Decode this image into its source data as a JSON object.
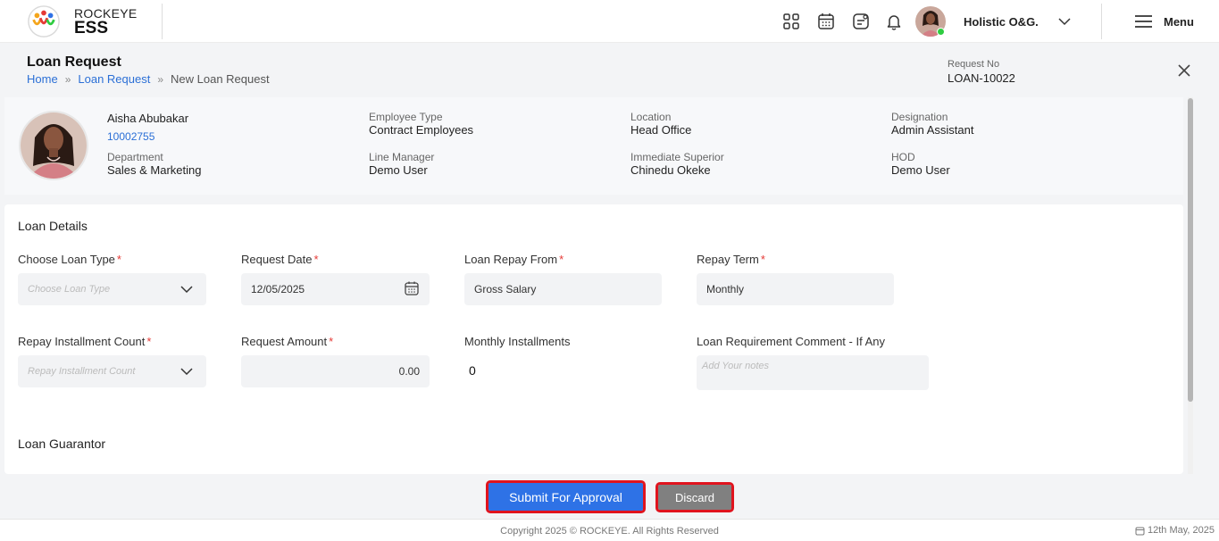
{
  "header": {
    "brand_top": "ROCKEYE",
    "brand_bottom": "ESS",
    "company": "Holistic O&G.",
    "menu_label": "Menu",
    "icons": [
      "apps-grid-icon",
      "calendar-icon",
      "chat-icon",
      "bell-icon"
    ]
  },
  "page": {
    "title": "Loan Request",
    "breadcrumb": [
      "Home",
      "Loan Request",
      "New Loan Request"
    ],
    "request_no_label": "Request No",
    "request_no": "LOAN-10022"
  },
  "employee": {
    "name": "Aisha Abubakar",
    "id": "10002755",
    "fields": [
      {
        "label": "Department",
        "value": "Sales & Marketing"
      },
      {
        "label": "Employee Type",
        "value": "Contract Employees"
      },
      {
        "label": "Line Manager",
        "value": "Demo User"
      },
      {
        "label": "Location",
        "value": "Head Office"
      },
      {
        "label": "Immediate Superior",
        "value": "Chinedu Okeke"
      },
      {
        "label": "Designation",
        "value": "Admin Assistant"
      },
      {
        "label": "HOD",
        "value": "Demo User"
      }
    ]
  },
  "loan_details": {
    "section_title": "Loan Details",
    "loan_type": {
      "label": "Choose Loan Type",
      "placeholder": "Choose Loan Type"
    },
    "request_date": {
      "label": "Request Date",
      "value": "12/05/2025"
    },
    "repay_from": {
      "label": "Loan Repay From",
      "value": "Gross Salary"
    },
    "repay_term": {
      "label": "Repay Term",
      "value": "Monthly"
    },
    "installment_count": {
      "label": "Repay Installment Count",
      "placeholder": "Repay Installment Count"
    },
    "request_amount": {
      "label": "Request Amount",
      "value": "0.00"
    },
    "monthly_installments": {
      "label": "Monthly Installments",
      "value": "0"
    },
    "comment": {
      "label": "Loan Requirement Comment - If Any",
      "placeholder": "Add Your notes"
    },
    "required_mark": "*"
  },
  "guarantor": {
    "section_title": "Loan Guarantor"
  },
  "actions": {
    "submit": "Submit For Approval",
    "discard": "Discard"
  },
  "footer": {
    "copyright": "Copyright 2025 © ROCKEYE. All Rights Reserved",
    "date": "12th May, 2025"
  },
  "colors": {
    "accent": "#2e72e6",
    "link": "#2b6fd6",
    "highlight": "#e0141e",
    "discard": "#808080"
  }
}
